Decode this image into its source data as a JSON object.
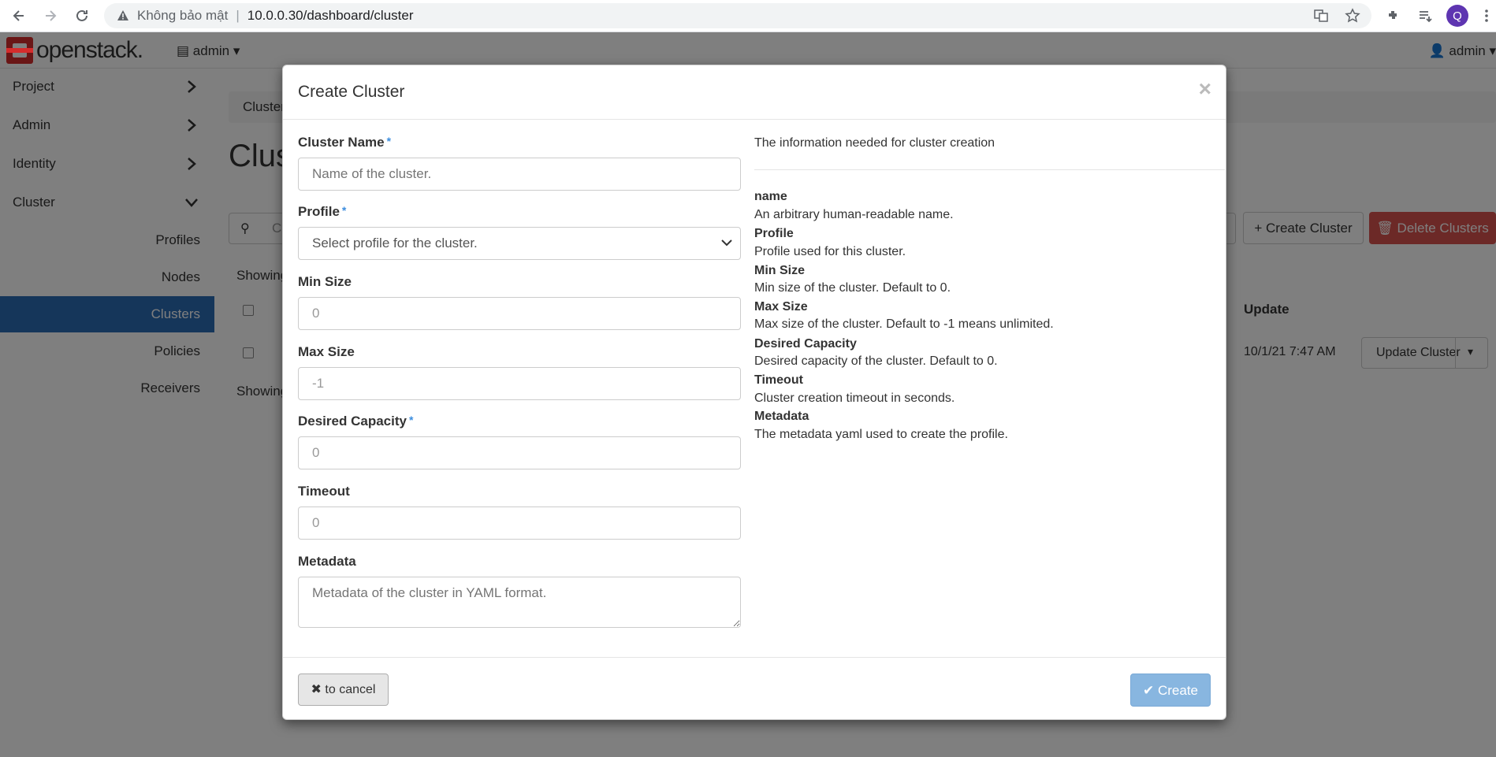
{
  "browser": {
    "security_label": "Không bảo mật",
    "separator": "|",
    "url": "10.0.0.30/dashboard/cluster",
    "profile_initial": "Q"
  },
  "topbar": {
    "logo_text": "openstack.",
    "project_menu": "admin",
    "user_menu": "admin"
  },
  "sidebar": {
    "items": [
      {
        "label": "Project"
      },
      {
        "label": "Admin"
      },
      {
        "label": "Identity"
      },
      {
        "label": "Cluster"
      }
    ],
    "sub_items": [
      {
        "label": "Profiles"
      },
      {
        "label": "Nodes"
      },
      {
        "label": "Clusters"
      },
      {
        "label": "Policies"
      },
      {
        "label": "Receivers"
      }
    ]
  },
  "background": {
    "breadcrumb": "Cluster",
    "page_title": "Clus",
    "search_placeholder": "C",
    "create_button": "Create Cluster",
    "delete_button": "Delete Clusters",
    "showing_top": "Showing",
    "showing_bottom": "Showing",
    "update_header": "Update",
    "row_date": "10/1/21 7:47 AM",
    "row_action": "Update Cluster"
  },
  "modal": {
    "title": "Create Cluster",
    "close_symbol": "×",
    "fields": {
      "name_label": "Cluster Name",
      "name_placeholder": "Name of the cluster.",
      "profile_label": "Profile",
      "profile_placeholder": "Select profile for the cluster.",
      "min_label": "Min Size",
      "min_value": "0",
      "max_label": "Max Size",
      "max_value": "-1",
      "desired_label": "Desired Capacity",
      "desired_value": "0",
      "timeout_label": "Timeout",
      "timeout_value": "0",
      "metadata_label": "Metadata",
      "metadata_placeholder": "Metadata of the cluster in YAML format."
    },
    "required_mark": "*",
    "help": {
      "intro": "The information needed for cluster creation",
      "terms": [
        {
          "term": "name",
          "desc": "An arbitrary human-readable name."
        },
        {
          "term": "Profile",
          "desc": "Profile used for this cluster."
        },
        {
          "term": "Min Size",
          "desc": "Min size of the cluster. Default to 0."
        },
        {
          "term": "Max Size",
          "desc": "Max size of the cluster. Default to -1 means unlimited."
        },
        {
          "term": "Desired Capacity",
          "desc": "Desired capacity of the cluster. Default to 0."
        },
        {
          "term": "Timeout",
          "desc": "Cluster creation timeout in seconds."
        },
        {
          "term": "Metadata",
          "desc": "The metadata yaml used to create the profile."
        }
      ]
    },
    "footer": {
      "cancel_label": "to cancel",
      "submit_label": "Create"
    }
  },
  "colors": {
    "accent": "#2a6cb5",
    "danger": "#d9534f",
    "submit_disabled": "#88b6e0",
    "required": "#3c8dde"
  }
}
